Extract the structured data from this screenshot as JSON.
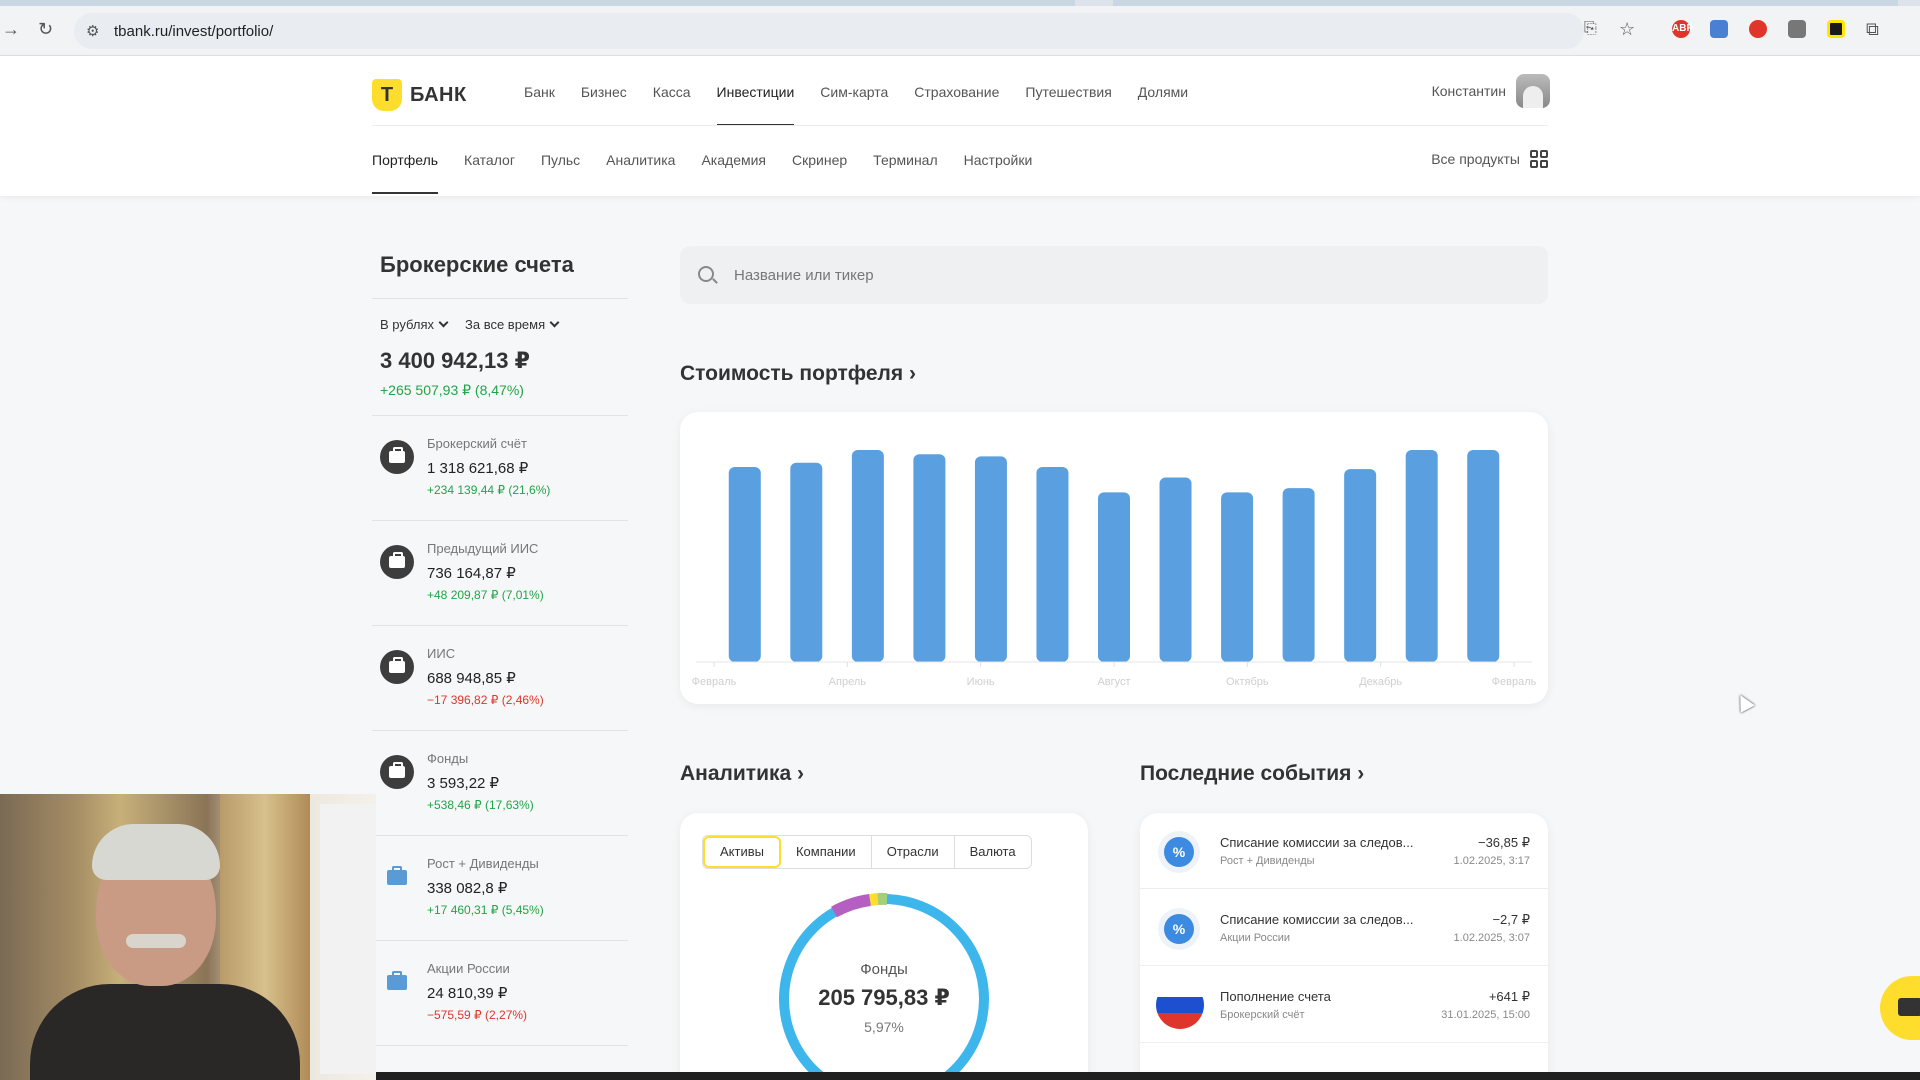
{
  "browser": {
    "url": "tbank.ru/invest/portfolio/",
    "ext_abp": "ABP"
  },
  "brand": {
    "logo_letter": "Т",
    "logo_word": "БАНК",
    "accent": "#ffdd2d"
  },
  "main_nav": [
    "Банк",
    "Бизнес",
    "Касса",
    "Инвестиции",
    "Сим-карта",
    "Страхование",
    "Путешествия",
    "Долями"
  ],
  "main_nav_active": "Инвестиции",
  "user": {
    "name": "Константин"
  },
  "sub_nav": [
    "Портфель",
    "Каталог",
    "Пульс",
    "Аналитика",
    "Академия",
    "Скринер",
    "Терминал",
    "Настройки"
  ],
  "sub_nav_active": "Портфель",
  "all_products": "Все продукты",
  "left": {
    "title": "Брокерские счета",
    "filter_currency": "В рублях",
    "filter_period": "За все время",
    "total": "3 400 942,13 ₽",
    "total_change": "+265 507,93 ₽ (8,47%)",
    "accounts": [
      {
        "name": "Брокерский счёт",
        "value": "1 318 621,68 ₽",
        "change": "+234 139,44 ₽ (21,6%)",
        "positive": true,
        "icon": "dark"
      },
      {
        "name": "Предыдущий ИИС",
        "value": "736 164,87 ₽",
        "change": "+48 209,87 ₽ (7,01%)",
        "positive": true,
        "icon": "dark"
      },
      {
        "name": "ИИС",
        "value": "688 948,85 ₽",
        "change": "−17 396,82 ₽ (2,46%)",
        "positive": false,
        "icon": "dark"
      },
      {
        "name": "Фонды",
        "value": "3 593,22 ₽",
        "change": "+538,46 ₽ (17,63%)",
        "positive": true,
        "icon": "dark"
      },
      {
        "name": "Рост + Дивиденды",
        "value": "338 082,8 ₽",
        "change": "+17 460,31 ₽ (5,45%)",
        "positive": true,
        "icon": "blue"
      },
      {
        "name": "Акции России",
        "value": "24 810,39 ₽",
        "change": "−575,59 ₽ (2,27%)",
        "positive": false,
        "icon": "blue"
      }
    ]
  },
  "search": {
    "placeholder": "Название или тикер"
  },
  "portfolio_title": "Стоимость портфеля ›",
  "chart_data": {
    "type": "bar",
    "x_labels": [
      "Февраль",
      "Апрель",
      "Июнь",
      "Август",
      "Октябрь",
      "Декабрь",
      "Февраль"
    ],
    "values": [
      92,
      94,
      100,
      98,
      97,
      92,
      80,
      87,
      80,
      82,
      91,
      100,
      100
    ],
    "ylim": [
      0,
      100
    ],
    "bar_color": "#5a9fe0",
    "grid": false
  },
  "analytics": {
    "title": "Аналитика ›",
    "tabs": [
      "Активы",
      "Компании",
      "Отрасли",
      "Валюта"
    ],
    "active_tab": "Активы",
    "donut_label": "Фонды",
    "donut_value": "205 795,83 ₽",
    "donut_percent": "5,97%"
  },
  "events": {
    "title": "Последние события ›",
    "items": [
      {
        "title": "Списание комиссии за следов...",
        "sub": "Рост + Дивиденды",
        "amount": "−36,85 ₽",
        "date": "1.02.2025, 3:17",
        "positive": false,
        "icon": "percent"
      },
      {
        "title": "Списание комиссии за следов...",
        "sub": "Акции России",
        "amount": "−2,7 ₽",
        "date": "1.02.2025, 3:07",
        "positive": false,
        "icon": "percent"
      },
      {
        "title": "Пополнение счета",
        "sub": "Брокерский счёт",
        "amount": "+641 ₽",
        "date": "31.01.2025, 15:00",
        "positive": true,
        "icon": "flag"
      }
    ]
  }
}
